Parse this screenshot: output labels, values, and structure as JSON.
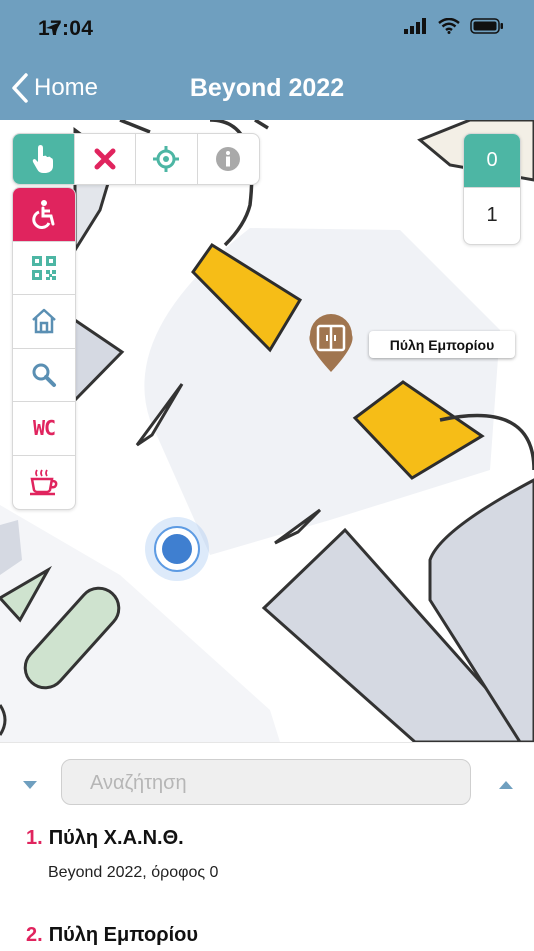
{
  "status": {
    "time": "17:04"
  },
  "nav": {
    "back_label": "Home",
    "title": "Beyond 2022"
  },
  "toolbar": {
    "icons": [
      "hand-pointer-icon",
      "close-icon",
      "crosshair-icon",
      "info-icon"
    ]
  },
  "sidebar": {
    "items": [
      "wheelchair-icon",
      "qr-code-icon",
      "home-icon",
      "search-icon",
      "wc-icon",
      "coffee-icon"
    ],
    "wc_label": "WC"
  },
  "floors": {
    "active": "0",
    "inactive": "1"
  },
  "map": {
    "poi_label": "Πύλη Εμπορίου"
  },
  "search": {
    "placeholder": "Αναζήτηση"
  },
  "results": [
    {
      "num": "1.",
      "title": "Πύλη Χ.Α.Ν.Θ.",
      "subtitle": "Beyond 2022, όροφος 0"
    },
    {
      "num": "2.",
      "title": "Πύλη Εμπορίου"
    }
  ],
  "colors": {
    "header": "#6f9fbf",
    "accent_teal": "#4db6a4",
    "accent_red": "#e0245e",
    "room_yellow": "#f6bd17"
  }
}
